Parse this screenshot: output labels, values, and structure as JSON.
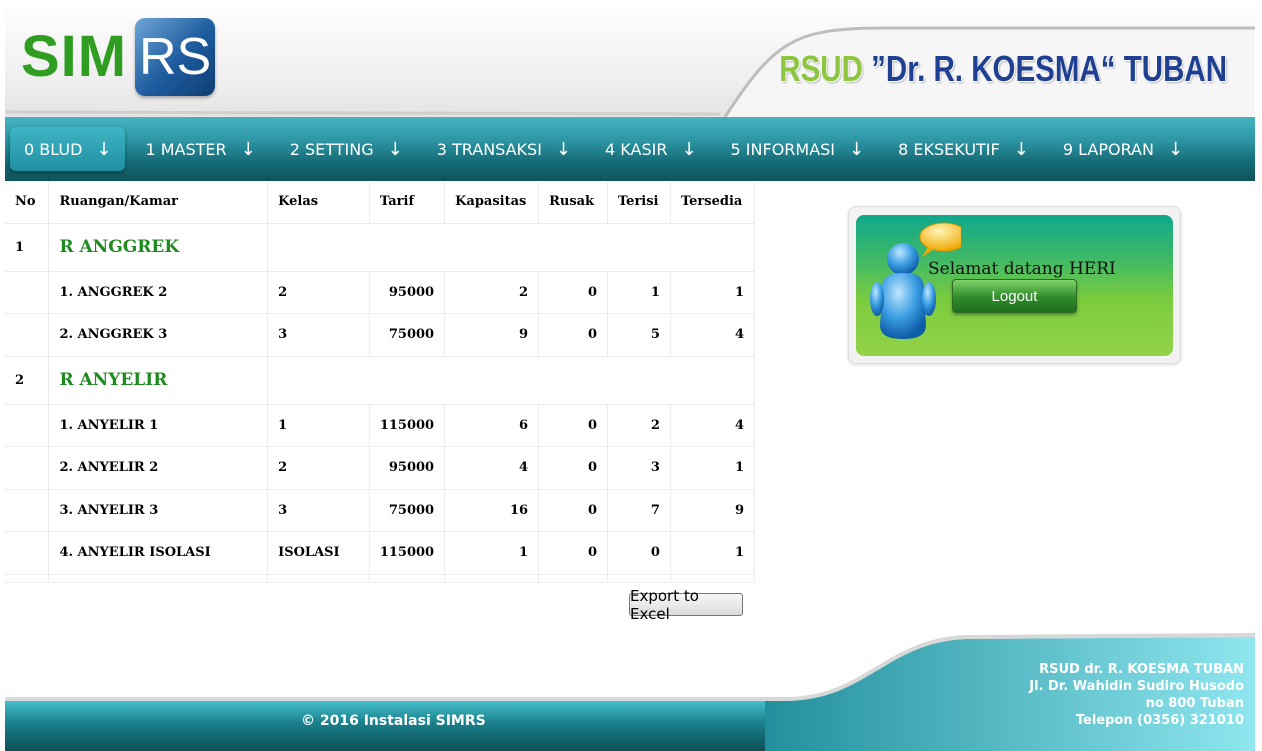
{
  "header": {
    "logo_sim": "SIM",
    "logo_rs": "RS",
    "hospital_prefix": "RSUD",
    "hospital_name": " ”Dr. R. KOESMA“ TUBAN"
  },
  "nav": {
    "items": [
      {
        "label": "0 BLUD",
        "arrow": "↓"
      },
      {
        "label": "1 MASTER",
        "arrow": "↓"
      },
      {
        "label": "2 SETTING",
        "arrow": "↓"
      },
      {
        "label": "3 TRANSAKSI",
        "arrow": "↓"
      },
      {
        "label": "4 KASIR",
        "arrow": "↓"
      },
      {
        "label": "5 INFORMASI",
        "arrow": "↓"
      },
      {
        "label": "8 EKSEKUTIF",
        "arrow": "↓"
      },
      {
        "label": "9 LAPORAN",
        "arrow": "↓"
      }
    ]
  },
  "table": {
    "headers": [
      "No",
      "Ruangan/Kamar",
      "Kelas",
      "Tarif",
      "Kapasitas",
      "Rusak",
      "Terisi",
      "Tersedia"
    ],
    "groups": [
      {
        "no": "1",
        "name": "R ANGGREK",
        "rows": [
          {
            "ruangan": "1. ANGGREK 2",
            "kelas": "2",
            "tarif": "95000",
            "kapasitas": "2",
            "rusak": "0",
            "terisi": "1",
            "tersedia": "1"
          },
          {
            "ruangan": "2. ANGGREK 3",
            "kelas": "3",
            "tarif": "75000",
            "kapasitas": "9",
            "rusak": "0",
            "terisi": "5",
            "tersedia": "4"
          }
        ]
      },
      {
        "no": "2",
        "name": "R ANYELIR",
        "rows": [
          {
            "ruangan": "1. ANYELIR 1",
            "kelas": "1",
            "tarif": "115000",
            "kapasitas": "6",
            "rusak": "0",
            "terisi": "2",
            "tersedia": "4"
          },
          {
            "ruangan": "2. ANYELIR 2",
            "kelas": "2",
            "tarif": "95000",
            "kapasitas": "4",
            "rusak": "0",
            "terisi": "3",
            "tersedia": "1"
          },
          {
            "ruangan": "3. ANYELIR 3",
            "kelas": "3",
            "tarif": "75000",
            "kapasitas": "16",
            "rusak": "0",
            "terisi": "7",
            "tersedia": "9"
          },
          {
            "ruangan": "4. ANYELIR ISOLASI",
            "kelas": "ISOLASI",
            "tarif": "115000",
            "kapasitas": "1",
            "rusak": "0",
            "terisi": "0",
            "tersedia": "1"
          }
        ]
      }
    ],
    "export_label": "Export to Excel"
  },
  "welcome": {
    "greeting": "Selamat datang HERI",
    "logout_label": "Logout",
    "icon": "user-chat-icon"
  },
  "footer": {
    "copyright": "© 2016 Instalasi SIMRS",
    "address_lines": [
      "RSUD dr. R. KOESMA TUBAN",
      "Jl. Dr. Wahidin Sudiro Husodo",
      "no 800 Tuban",
      "Telepon (0356) 321010"
    ]
  },
  "colors": {
    "nav_teal": "#156c77",
    "group_green": "#1f8a1f",
    "logo_green": "#2f9d1f",
    "logo_blue": "#1d5b9e"
  }
}
